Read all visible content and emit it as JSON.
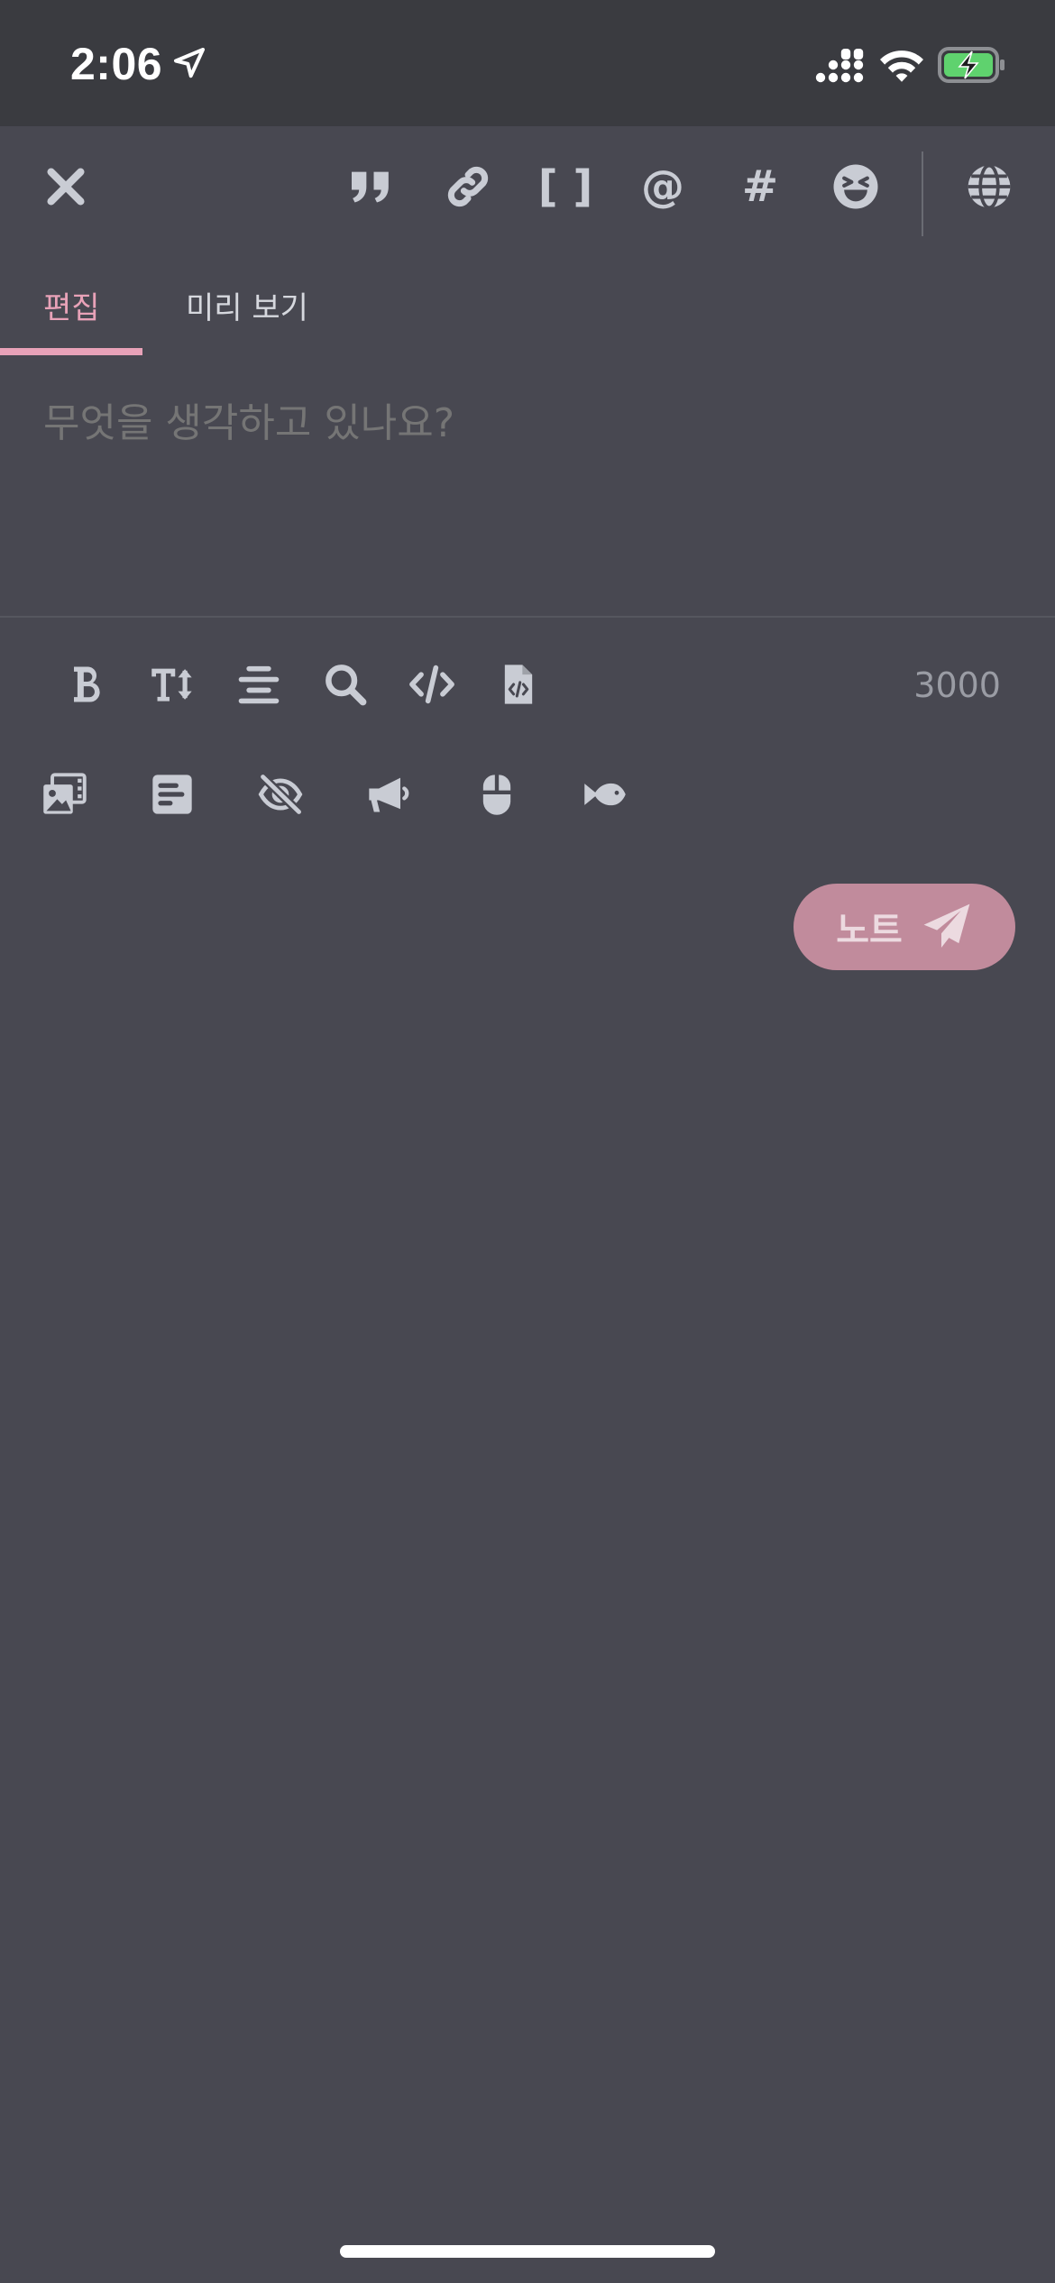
{
  "status_bar": {
    "time": "2:06"
  },
  "toolbar": {
    "close_icon": "close-icon",
    "quote_icon": "quote-icon",
    "link_icon": "link-icon",
    "brackets_label": "[ ]",
    "mention_label": "@",
    "hashtag_label": "#",
    "emoji_icon": "emoji-icon",
    "visibility_icon": "globe-icon"
  },
  "tabs": [
    {
      "label": "편집",
      "active": true
    },
    {
      "label": "미리 보기",
      "active": false
    }
  ],
  "editor": {
    "placeholder": "무엇을 생각하고 있나요?",
    "value": ""
  },
  "format_bar": {
    "icons": [
      "bold-icon",
      "text-size-icon",
      "align-center-icon",
      "search-icon",
      "code-icon",
      "code-file-icon"
    ],
    "char_count": "3000"
  },
  "attach_bar": {
    "icons": [
      "images-icon",
      "poll-icon",
      "hide-content-icon",
      "announcement-icon",
      "mouse-icon",
      "fish-icon"
    ]
  },
  "submit": {
    "label": "노트"
  },
  "colors": {
    "background": "#484851",
    "status_bar": "#3a3b40",
    "accent": "#e8a2b8",
    "button": "#c18b9c",
    "icon": "#c9ccd4"
  }
}
